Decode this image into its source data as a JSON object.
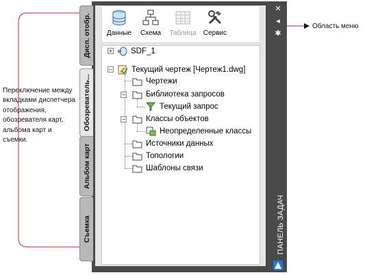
{
  "annotations": {
    "left": "Переключение между вкладками диспетчера отображения, обозревателя карт, альбома карт и съемки.",
    "right": "Область меню"
  },
  "tabs": [
    {
      "label": "Дисп. отобр.",
      "active": false
    },
    {
      "label": "Обозреватель...",
      "active": true
    },
    {
      "label": "Альбом карт",
      "active": false
    },
    {
      "label": "Съемка",
      "active": false
    }
  ],
  "toolbar": {
    "items": [
      {
        "label": "Данные",
        "icon": "database-icon",
        "enabled": true
      },
      {
        "label": "Схема",
        "icon": "schema-icon",
        "enabled": true
      },
      {
        "label": "Таблица",
        "icon": "table-icon",
        "enabled": false
      },
      {
        "label": "Сервис",
        "icon": "tools-icon",
        "enabled": true
      }
    ]
  },
  "tree": {
    "sdf": "SDF_1",
    "current_drawing": "Текущий чертеж [Чертеж1.dwg]",
    "drawings": "Чертежи",
    "query_library": "Библиотека запросов",
    "current_query": "Текущий запрос",
    "object_classes": "Классы объектов",
    "undefined_classes": "Неопределенные классы",
    "data_sources": "Источники данных",
    "topologies": "Топологии",
    "link_templates": "Шаблоны связи"
  },
  "palette": {
    "title": "ПАНЕЛЬ ЗАДАЧ",
    "buttons": [
      "close-icon",
      "autohide-icon",
      "properties-icon"
    ]
  },
  "colors": {
    "palette_frame": "#4a4a4a",
    "callout_line": "#d0202a",
    "folder": "#f2c94c",
    "accent": "#1b7bd6"
  }
}
